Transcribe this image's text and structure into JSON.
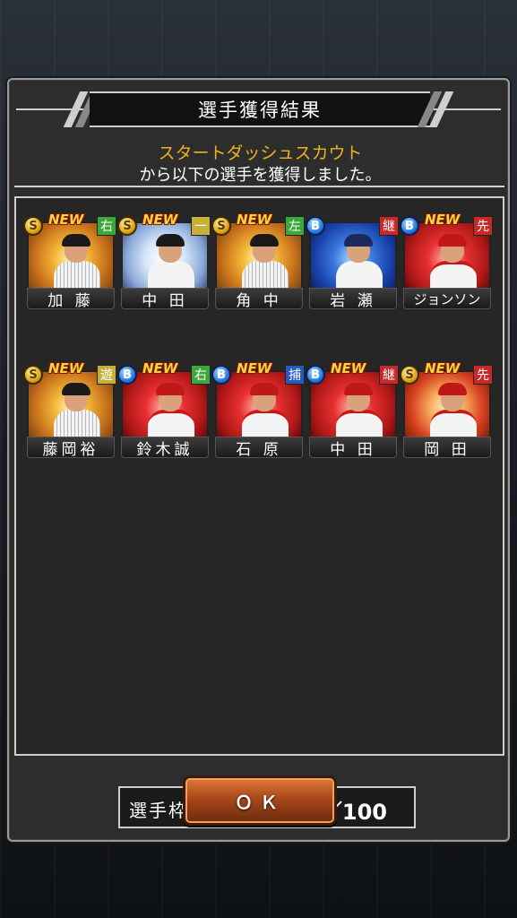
{
  "dialog": {
    "title": "選手獲得結果",
    "scout_name": "スタートダッシュスカウト",
    "message": "から以下の選手を獲得しました。"
  },
  "players": [
    {
      "name": "加 藤",
      "rank": "S",
      "position": "右",
      "new": "NEW"
    },
    {
      "name": "中 田",
      "rank": "S",
      "position": "一",
      "new": "NEW"
    },
    {
      "name": "角 中",
      "rank": "S",
      "position": "左",
      "new": "NEW"
    },
    {
      "name": "岩 瀬",
      "rank": "B",
      "position": "継",
      "new": ""
    },
    {
      "name": "ジョンソン",
      "rank": "B",
      "position": "先",
      "new": "NEW"
    },
    {
      "name": "藤岡裕",
      "rank": "S",
      "position": "遊",
      "new": "NEW"
    },
    {
      "name": "鈴木誠",
      "rank": "B",
      "position": "右",
      "new": "NEW"
    },
    {
      "name": "石 原",
      "rank": "B",
      "position": "捕",
      "new": "NEW"
    },
    {
      "name": "中 田",
      "rank": "B",
      "position": "継",
      "new": "NEW"
    },
    {
      "name": "岡 田",
      "rank": "S",
      "position": "先",
      "new": "NEW"
    }
  ],
  "slots": {
    "label": "選手枠：",
    "value": "65／100"
  },
  "ok_button": {
    "label": "ＯＫ"
  }
}
